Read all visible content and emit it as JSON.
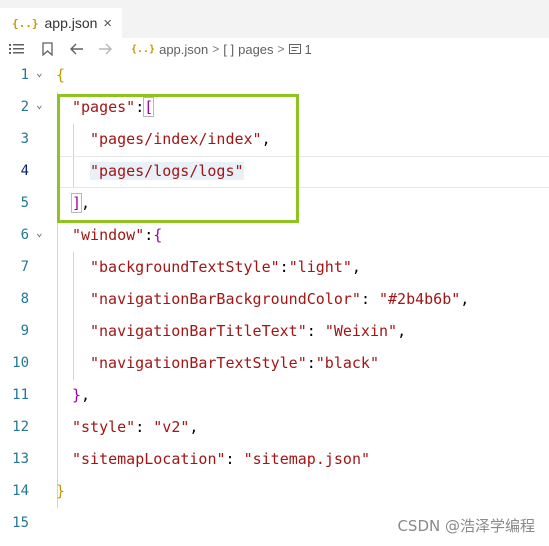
{
  "tab": {
    "icon": "{..}",
    "title": "app.json",
    "close": "×"
  },
  "toolbar": {
    "crumb_file_icon": "{..}",
    "crumb_file": "app.json",
    "crumb_sep": ">",
    "crumb_array_icon": "[ ]",
    "crumb_array": "pages",
    "crumb_item": "1"
  },
  "lines": [
    "1",
    "2",
    "3",
    "4",
    "5",
    "6",
    "7",
    "8",
    "9",
    "10",
    "11",
    "12",
    "13",
    "14",
    "15"
  ],
  "code": {
    "l1_open": "{",
    "l2_key": "\"pages\"",
    "l2_colon": ":",
    "l2_bracket": "[",
    "l3_str": "\"pages/index/index\"",
    "l3_comma": ",",
    "l4_str": "\"pages/logs/logs\"",
    "l5_bracket": "]",
    "l5_comma": ",",
    "l6_key": "\"window\"",
    "l6_colon": ":",
    "l6_brace": "{",
    "l7_key": "\"backgroundTextStyle\"",
    "l7_colon": ":",
    "l7_val": "\"light\"",
    "l7_comma": ",",
    "l8_key": "\"navigationBarBackgroundColor\"",
    "l8_colon": ": ",
    "l8_val": "\"#2b4b6b\"",
    "l8_comma": ",",
    "l9_key": "\"navigationBarTitleText\"",
    "l9_colon": ": ",
    "l9_val": "\"Weixin\"",
    "l9_comma": ",",
    "l10_key": "\"navigationBarTextStyle\"",
    "l10_colon": ":",
    "l10_val": "\"black\"",
    "l11_brace": "}",
    "l11_comma": ",",
    "l12_key": "\"style\"",
    "l12_colon": ": ",
    "l12_val": "\"v2\"",
    "l12_comma": ",",
    "l13_key": "\"sitemapLocation\"",
    "l13_colon": ": ",
    "l13_val": "\"sitemap.json\"",
    "l14_close": "}"
  },
  "watermark": "CSDN @浩泽学编程",
  "colors": {
    "annotation_box": "#8fc31f",
    "string": "#a31515",
    "brace": "#c09a00",
    "bracket": "#a100a1",
    "line_number": "#237893"
  }
}
